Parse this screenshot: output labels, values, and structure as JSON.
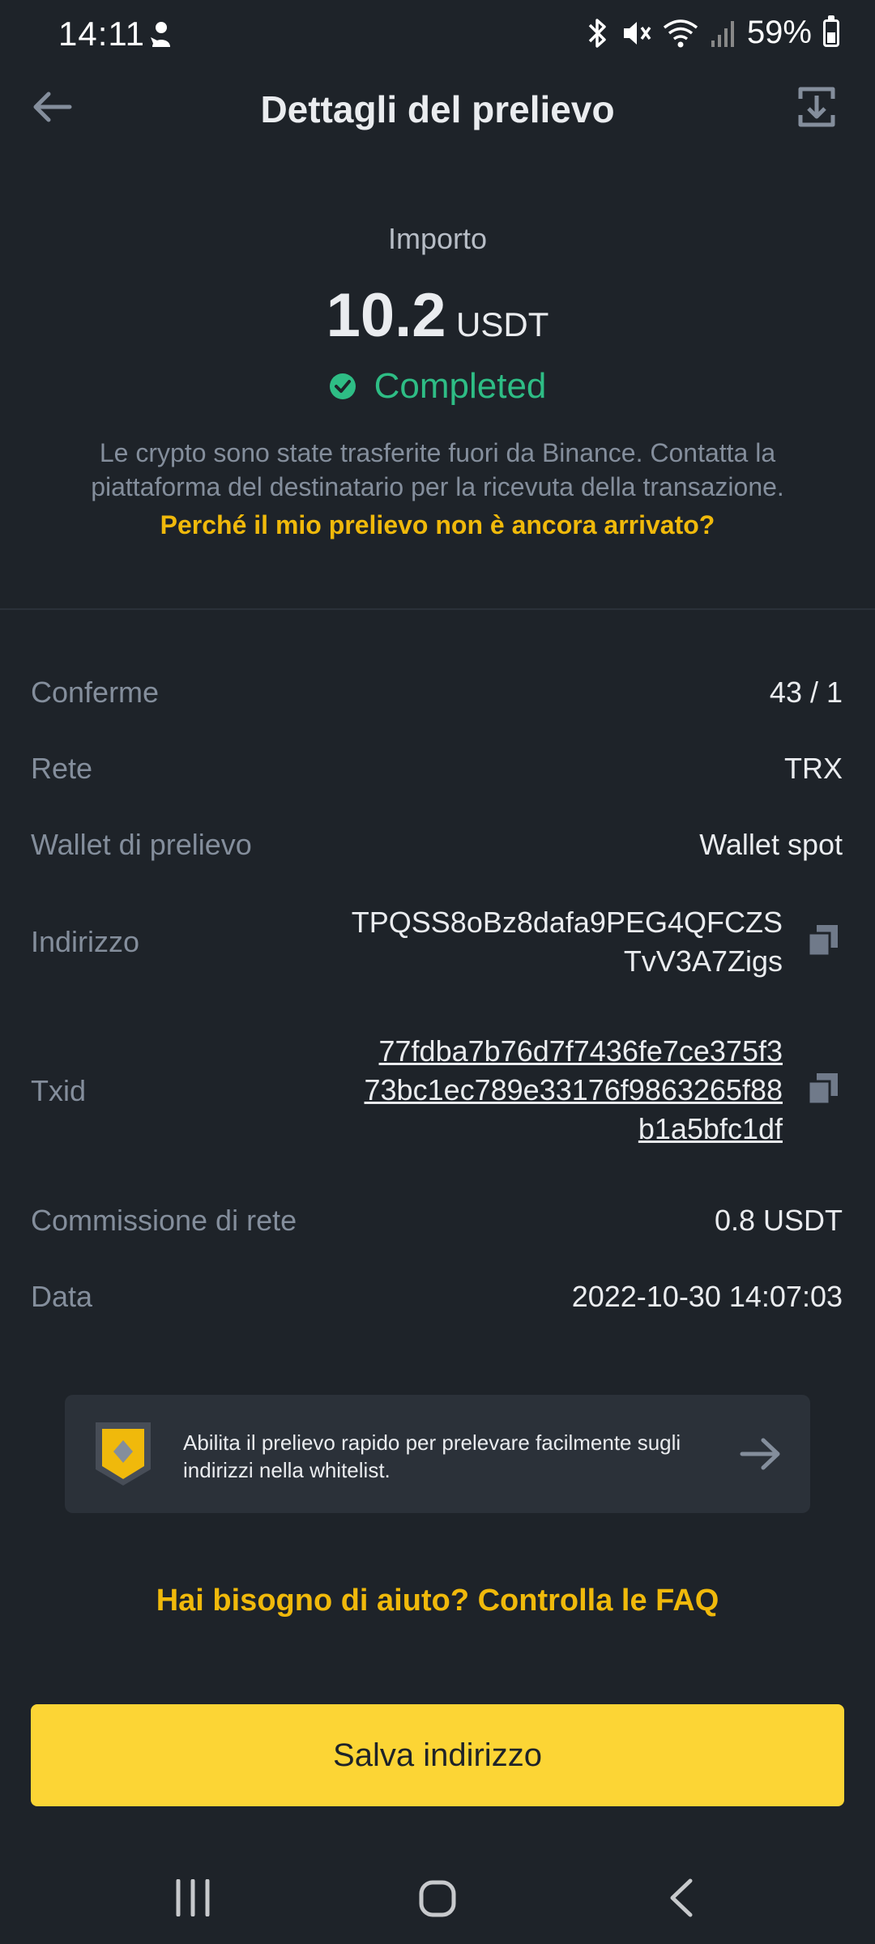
{
  "status_bar": {
    "time": "14:11",
    "battery": "59%"
  },
  "header": {
    "title": "Dettagli del prelievo"
  },
  "amount": {
    "label": "Importo",
    "value": "10.2",
    "unit": "USDT",
    "status": "Completed",
    "description": "Le crypto sono state trasferite fuori da Binance. Contatta la piattaforma del destinatario per la ricevuta della transazione.",
    "help_link": "Perché il mio prelievo non è ancora arrivato?"
  },
  "details": {
    "confirmations_label": "Conferme",
    "confirmations_value": "43 / 1",
    "network_label": "Rete",
    "network_value": "TRX",
    "wallet_label": "Wallet di prelievo",
    "wallet_value": "Wallet spot",
    "address_label": "Indirizzo",
    "address_line1": "TPQSS8oBz8dafa9PEG4QFCZS",
    "address_line2": "TvV3A7Zigs",
    "txid_label": "Txid",
    "txid_line1": "77fdba7b76d7f7436fe7ce375f3",
    "txid_line2": "73bc1ec789e33176f9863265f88",
    "txid_line3": "b1a5bfc1df",
    "fee_label": "Commissione di rete",
    "fee_value": "0.8 USDT",
    "date_label": "Data",
    "date_value": "2022-10-30 14:07:03"
  },
  "info_card": {
    "text": "Abilita il prelievo rapido per prelevare facilmente sugli indirizzi nella whitelist."
  },
  "faq_link": "Hai bisogno di aiuto? Controlla le FAQ",
  "save_button": "Salva indirizzo",
  "colors": {
    "background": "#1e2329",
    "accent": "#f0b90b",
    "button": "#fcd535",
    "success": "#2ebd85"
  }
}
